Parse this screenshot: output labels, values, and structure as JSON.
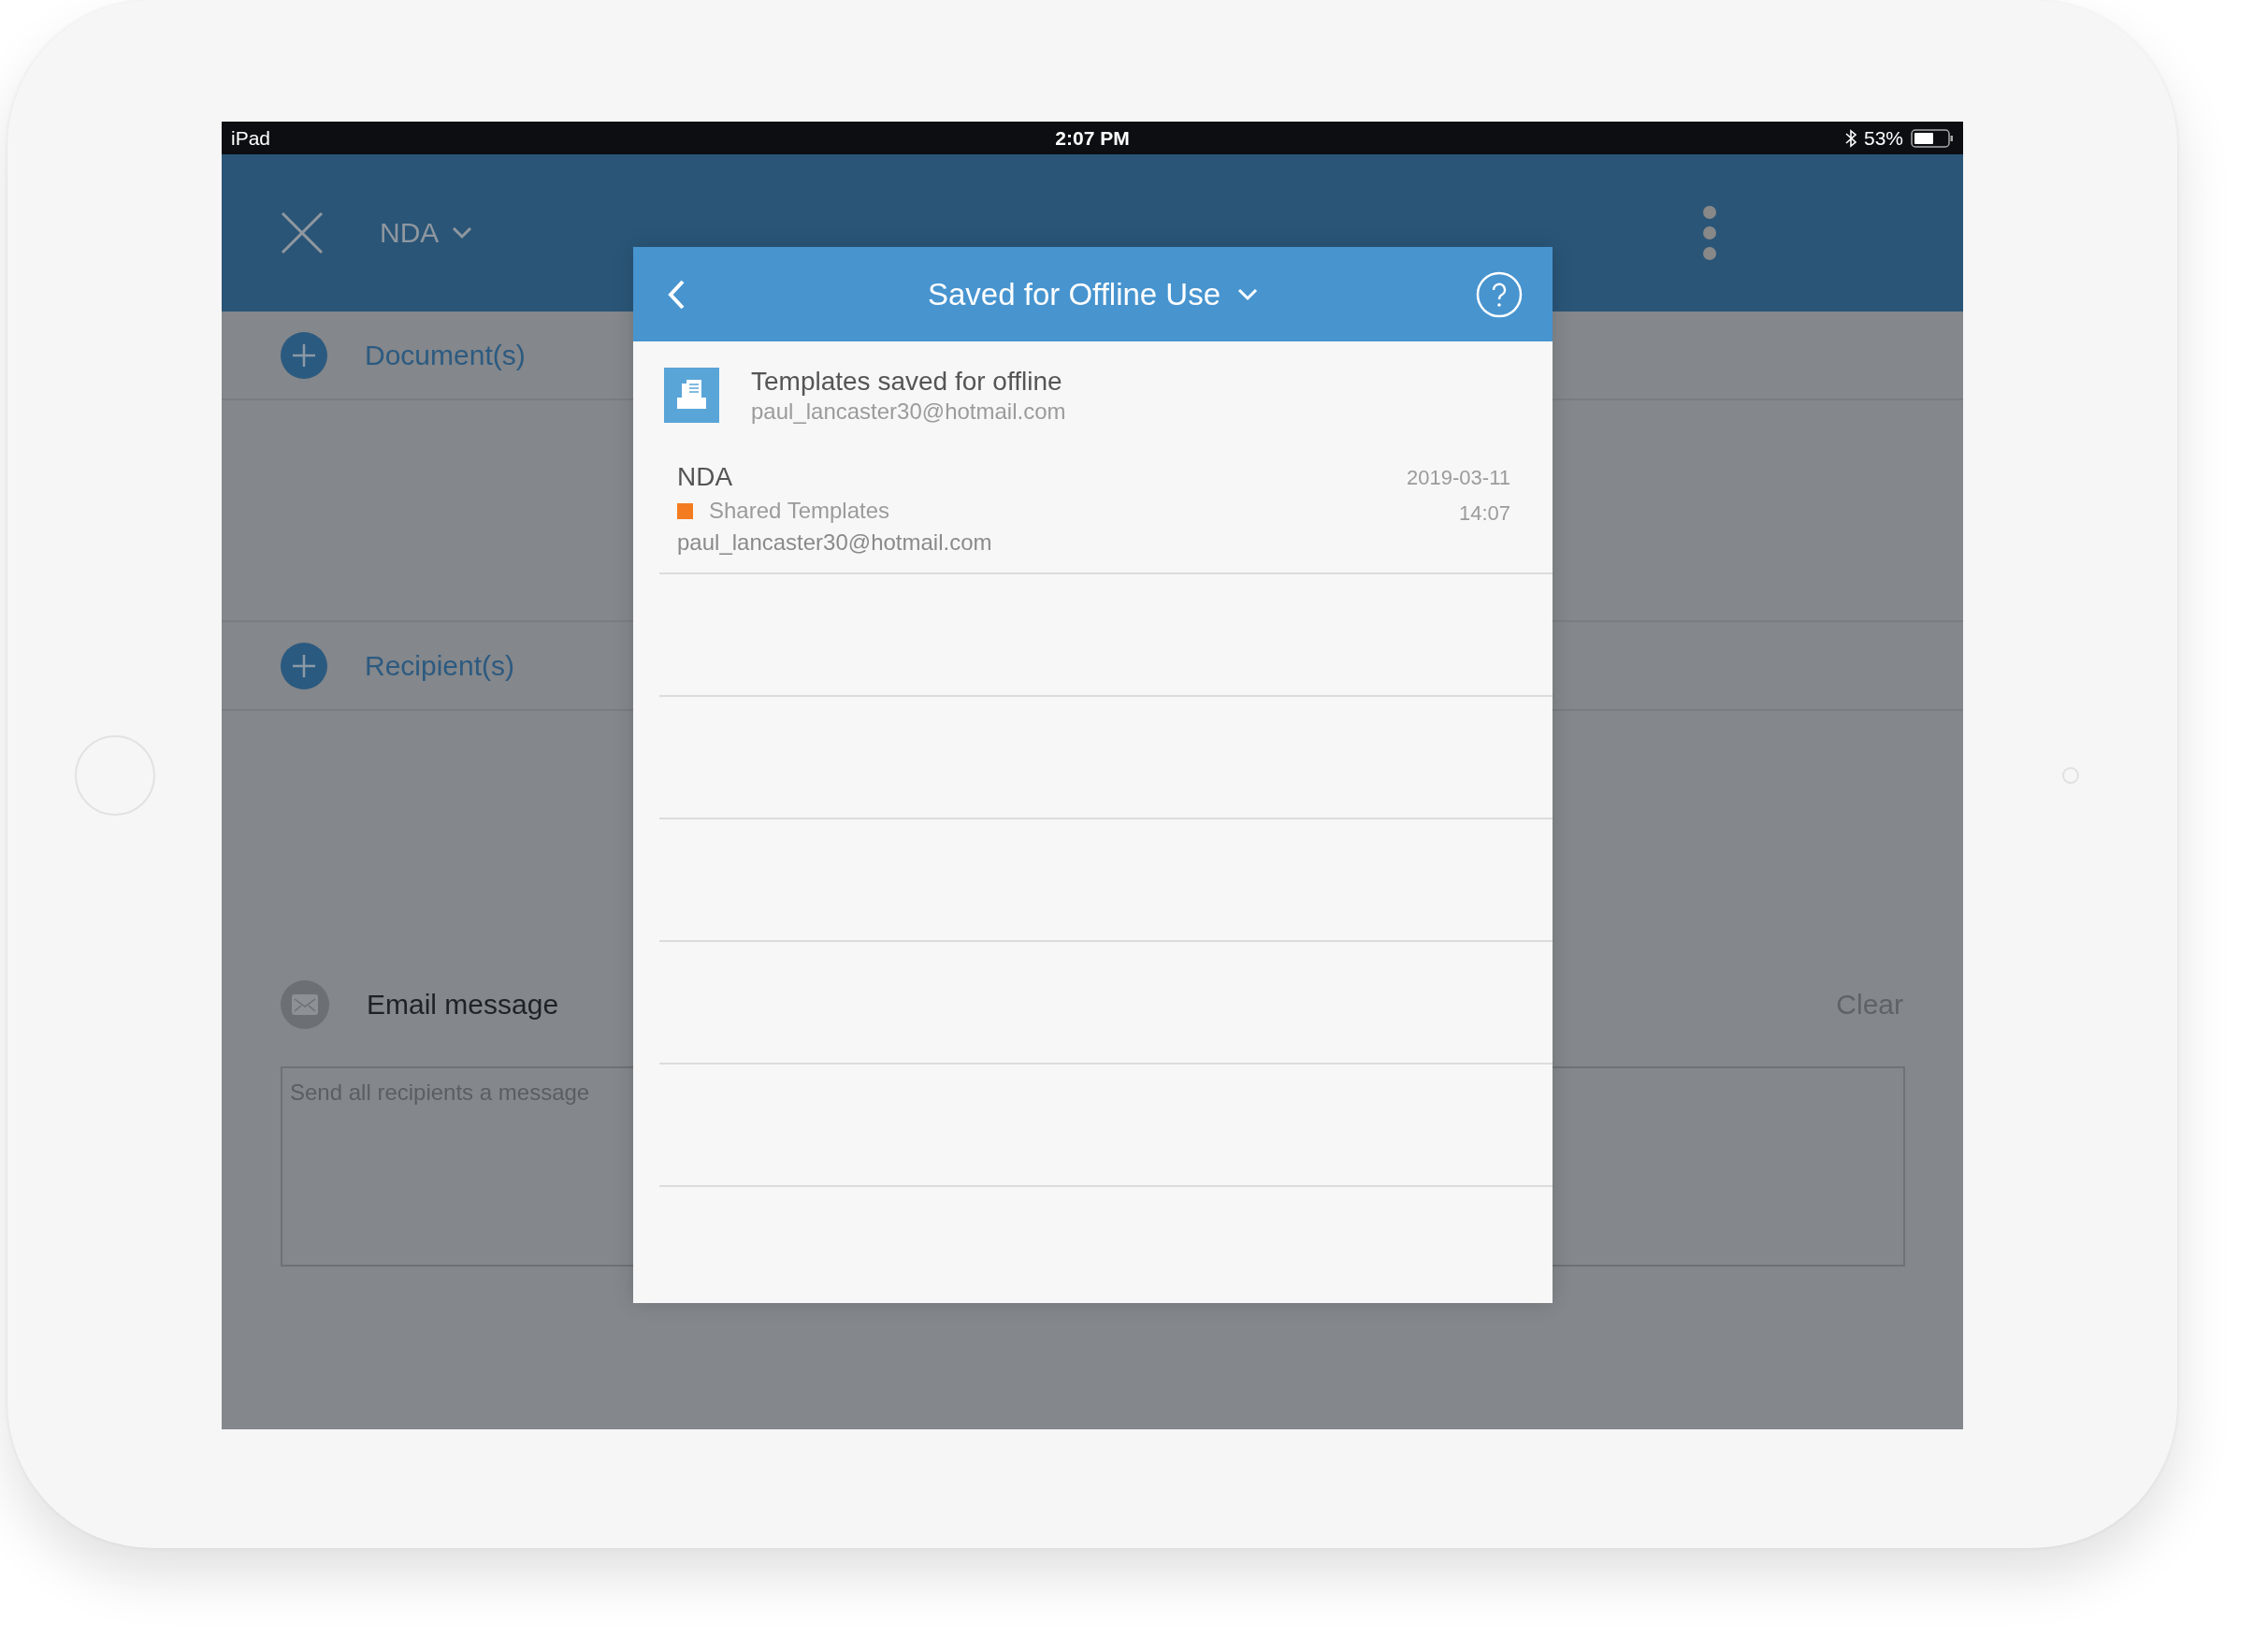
{
  "status_bar": {
    "device": "iPad",
    "time": "2:07 PM",
    "battery": "53%"
  },
  "header": {
    "title": "NDA"
  },
  "sections": [
    {
      "label": "Document(s)"
    },
    {
      "label": "Recipient(s)"
    }
  ],
  "email": {
    "label": "Email message",
    "clear": "Clear",
    "placeholder": "Send all recipients a message"
  },
  "modal": {
    "title": "Saved for Offline Use",
    "source": {
      "title": "Templates saved for offline",
      "account": "paul_lancaster30@hotmail.com"
    },
    "items": [
      {
        "name": "NDA",
        "folder": "Shared Templates",
        "color": "#f47c20",
        "owner": "paul_lancaster30@hotmail.com",
        "date": "2019-03-11",
        "time": "14:07"
      }
    ]
  }
}
